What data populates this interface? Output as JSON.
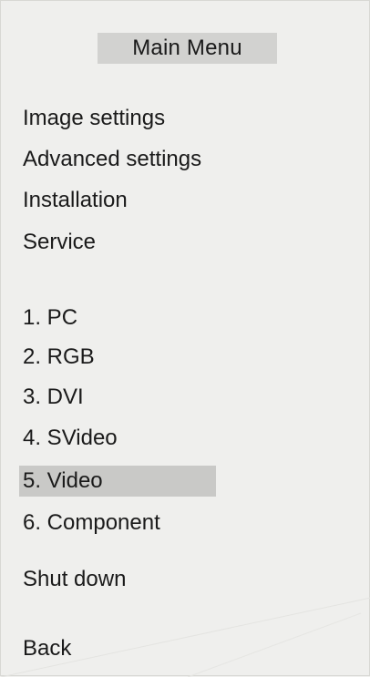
{
  "menu": {
    "title": "Main Menu",
    "settings": [
      {
        "label": "Image settings"
      },
      {
        "label": "Advanced settings"
      },
      {
        "label": "Installation"
      },
      {
        "label": "Service"
      }
    ],
    "sources": [
      {
        "label": "1. PC"
      },
      {
        "label": "2. RGB"
      },
      {
        "label": "3. DVI"
      },
      {
        "label": "4. SVideo"
      },
      {
        "label": "5. Video",
        "selected": true
      },
      {
        "label": "6. Component"
      }
    ],
    "shutdown_label": "Shut down",
    "back_label": "Back"
  },
  "colors": {
    "background": "#efefed",
    "title_background": "#d2d2d0",
    "selection": "#c9c9c7",
    "text": "#1a1a1a"
  }
}
